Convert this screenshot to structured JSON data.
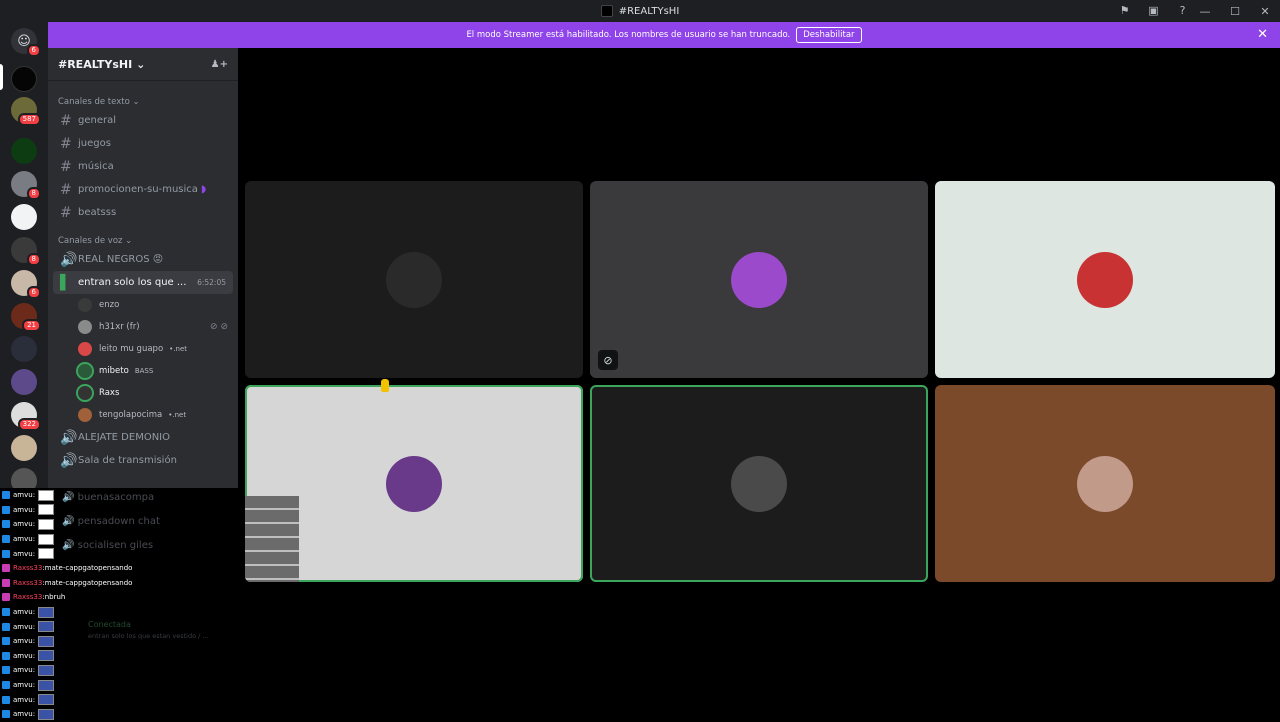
{
  "window": {
    "title": "#REALTYsHI"
  },
  "notice": {
    "text": "El modo Streamer está habilitado. Los nombres de usuario se han truncado.",
    "button": "Deshabilitar"
  },
  "guilds": {
    "badges": [
      "6",
      "587",
      "8",
      "8",
      "6",
      "21",
      "322"
    ]
  },
  "server": {
    "name": "#REALTYsHI"
  },
  "text_category": "Canales de texto",
  "text_channels": [
    "general",
    "juegos",
    "música",
    "promocionen-su-musica",
    "beatsss"
  ],
  "voice_category": "Canales de voz",
  "voice_channels": {
    "real": "REAL NEGROS 😡",
    "active": "entran solo los que ...",
    "active_time": "6:52:05",
    "alejate": "ALEJATE DEMONIO",
    "sala": "Sala de transmisión",
    "buenas": "buenasacompa",
    "pensado": "pensadown chat",
    "social": "socialisen giles"
  },
  "voice_users": [
    {
      "name": "enzo",
      "tag": ""
    },
    {
      "name": "h31xr (fr)",
      "tag": ""
    },
    {
      "name": "leito mu guapo",
      "tag": "•.net"
    },
    {
      "name": "mibeto",
      "tag": "BASS"
    },
    {
      "name": "Raxs",
      "tag": ""
    },
    {
      "name": "tengolapocima",
      "tag": "•.net"
    }
  ],
  "chat_overlay": [
    {
      "user": "amvu",
      "msg": ""
    },
    {
      "user": "amvu",
      "msg": ""
    },
    {
      "user": "amvu",
      "msg": ""
    },
    {
      "user": "amvu",
      "msg": ""
    },
    {
      "user": "amvu",
      "msg": ""
    },
    {
      "user": "Raxss33",
      "msg": "mate-cappgatopensando"
    },
    {
      "user": "Raxss33",
      "msg": "mate-cappgatopensando"
    },
    {
      "user": "Raxss33",
      "msg": "nbruh"
    },
    {
      "user": "amvu",
      "msg": ""
    },
    {
      "user": "amvu",
      "msg": ""
    },
    {
      "user": "amvu",
      "msg": ""
    },
    {
      "user": "amvu",
      "msg": ""
    },
    {
      "user": "amvu",
      "msg": ""
    },
    {
      "user": "amvu",
      "msg": ""
    },
    {
      "user": "amvu",
      "msg": ""
    },
    {
      "user": "amvu",
      "msg": ""
    }
  ],
  "voice_status": {
    "connected": "Conectada",
    "channel": "entran solo los que estan vestido / ..."
  },
  "colors": {
    "accent": "#8e44e8",
    "speaking": "#3ba55c"
  }
}
